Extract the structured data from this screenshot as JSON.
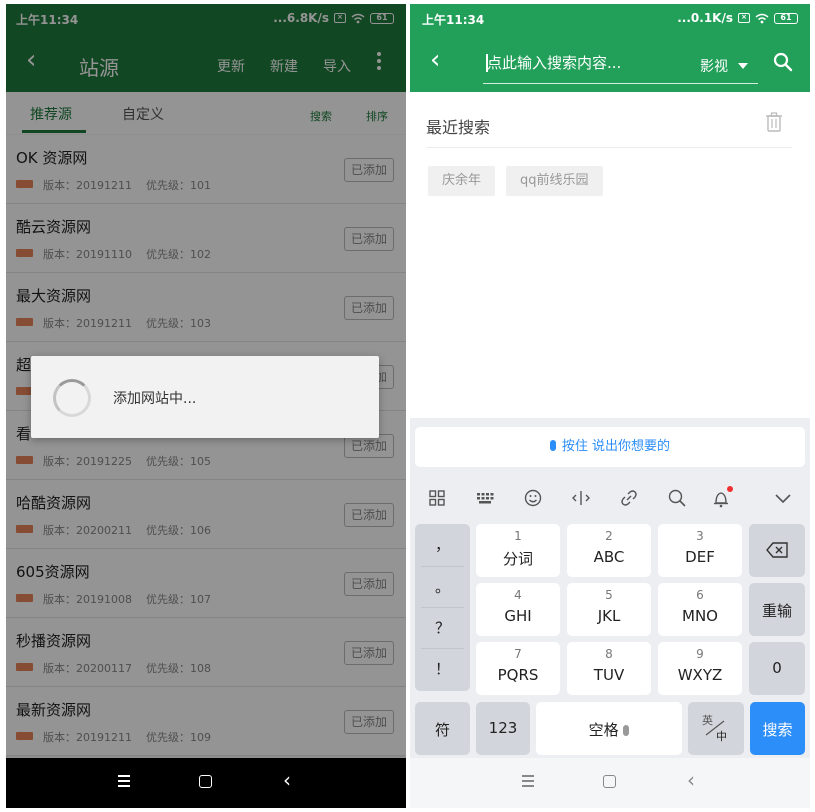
{
  "left": {
    "status": {
      "time": "上午11:34",
      "speed": "...6.8K/s",
      "battery": "61"
    },
    "toolbar": {
      "back": "‹",
      "title": "站源",
      "actions": [
        "更新",
        "新建",
        "导入"
      ]
    },
    "tabs": {
      "recommended": "推荐源",
      "custom": "自定义",
      "search": "搜索",
      "sort": "排序"
    },
    "items": [
      {
        "name": "OK 资源网",
        "version": "版本：20191211",
        "priority": "优先级：101",
        "button": "已添加"
      },
      {
        "name": "酷云资源网",
        "version": "版本：20191110",
        "priority": "优先级：102",
        "button": "已添加"
      },
      {
        "name": "最大资源网",
        "version": "版本：20191211",
        "priority": "优先级：103",
        "button": "已添加"
      },
      {
        "name": "超",
        "version": "",
        "priority": "",
        "button": "已添加"
      },
      {
        "name": "看",
        "version": "版本：20191225",
        "priority": "优先级：105",
        "button": "已添加"
      },
      {
        "name": "哈酷资源网",
        "version": "版本：20200211",
        "priority": "优先级：106",
        "button": "已添加"
      },
      {
        "name": "605资源网",
        "version": "版本：20191008",
        "priority": "优先级：107",
        "button": "已添加"
      },
      {
        "name": "秒播资源网",
        "version": "版本：20200117",
        "priority": "优先级：108",
        "button": "已添加"
      },
      {
        "name": "最新资源网",
        "version": "版本：20191211",
        "priority": "优先级：109",
        "button": "已添加"
      }
    ],
    "dialog": {
      "message": "添加网站中..."
    },
    "navbar": {
      "back": "‹"
    }
  },
  "right": {
    "status": {
      "time": "上午11:34",
      "speed": "...0.1K/s",
      "battery": "61"
    },
    "toolbar": {
      "back": "‹",
      "search_placeholder": "点此输入搜索内容...",
      "category": "影视"
    },
    "recent": {
      "label": "最近搜索",
      "chips": [
        "庆余年",
        "qq前线乐园"
      ]
    },
    "keyboard": {
      "voice_hint": "按住 说出你想要的",
      "side_punct": [
        "，",
        "。",
        "？",
        "！"
      ],
      "rows": [
        [
          {
            "n": "1",
            "l": "分词"
          },
          {
            "n": "2",
            "l": "ABC"
          },
          {
            "n": "3",
            "l": "DEF"
          }
        ],
        [
          {
            "n": "4",
            "l": "GHI"
          },
          {
            "n": "5",
            "l": "JKL"
          },
          {
            "n": "6",
            "l": "MNO"
          }
        ],
        [
          {
            "n": "7",
            "l": "PQRS"
          },
          {
            "n": "8",
            "l": "TUV"
          },
          {
            "n": "9",
            "l": "WXYZ"
          }
        ]
      ],
      "reenter": "重输",
      "zero": "0",
      "symbol": "符",
      "num": "123",
      "space": "空格",
      "lang_top": "英",
      "lang_bottom": "中",
      "search": "搜索"
    },
    "navbar": {
      "back": "‹"
    }
  },
  "colors": {
    "left_header": "#1e7a3c",
    "right_header": "#22a05a",
    "accent_blue": "#2c8ef8",
    "tag_orange": "#e8865a"
  }
}
